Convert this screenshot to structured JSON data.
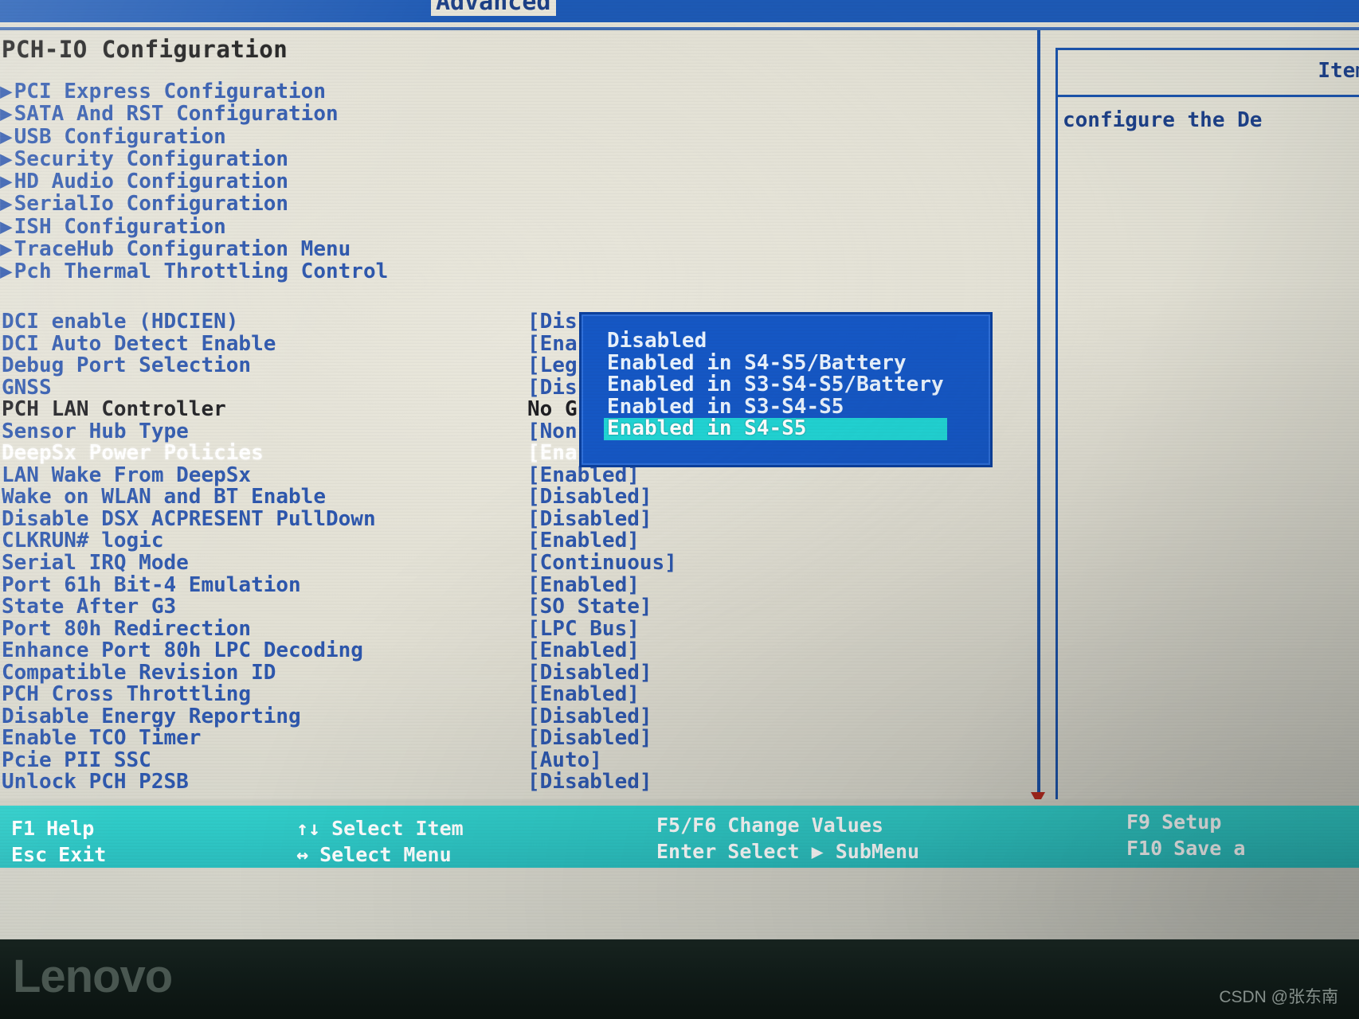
{
  "menubar": {
    "active_tab": "Advanced"
  },
  "page_title": "PCH-IO Configuration",
  "help_panel": {
    "title": "Item",
    "body": "configure the De"
  },
  "submenus": [
    {
      "label": "PCI Express Configuration"
    },
    {
      "label": "SATA And RST Configuration"
    },
    {
      "label": "USB Configuration"
    },
    {
      "label": "Security Configuration"
    },
    {
      "label": "HD Audio Configuration"
    },
    {
      "label": "SerialIo Configuration"
    },
    {
      "label": "ISH Configuration"
    },
    {
      "label": "TraceHub Configuration Menu"
    },
    {
      "label": "Pch Thermal Throttling Control"
    }
  ],
  "options": [
    {
      "label": "DCI enable (HDCIEN)",
      "value": "[Dis",
      "state": "normal"
    },
    {
      "label": "DCI Auto Detect Enable",
      "value": "[Ena",
      "state": "normal"
    },
    {
      "label": "Debug Port Selection",
      "value": "[Leg",
      "state": "normal"
    },
    {
      "label": "GNSS",
      "value": "[Dis",
      "state": "normal"
    },
    {
      "label": "PCH LAN Controller",
      "value": "No G",
      "state": "info"
    },
    {
      "label": "Sensor Hub Type",
      "value": "[Non",
      "state": "normal"
    },
    {
      "label": "DeepSx Power Policies",
      "value": "[Ena",
      "state": "selected"
    },
    {
      "label": "LAN Wake From DeepSx",
      "value": "[Enabled]",
      "state": "normal"
    },
    {
      "label": "Wake on WLAN and BT Enable",
      "value": "[Disabled]",
      "state": "normal"
    },
    {
      "label": "Disable DSX ACPRESENT PullDown",
      "value": "[Disabled]",
      "state": "normal"
    },
    {
      "label": "CLKRUN# logic",
      "value": "[Enabled]",
      "state": "normal"
    },
    {
      "label": "Serial IRQ Mode",
      "value": "[Continuous]",
      "state": "normal"
    },
    {
      "label": "Port 61h Bit-4 Emulation",
      "value": "[Enabled]",
      "state": "normal"
    },
    {
      "label": "State After G3",
      "value": "[SO State]",
      "state": "normal"
    },
    {
      "label": "Port 80h Redirection",
      "value": "[LPC Bus]",
      "state": "normal"
    },
    {
      "label": "Enhance Port 80h LPC Decoding",
      "value": "[Enabled]",
      "state": "normal"
    },
    {
      "label": "Compatible Revision ID",
      "value": "[Disabled]",
      "state": "normal"
    },
    {
      "label": "PCH Cross Throttling",
      "value": "[Enabled]",
      "state": "normal"
    },
    {
      "label": "Disable Energy Reporting",
      "value": "[Disabled]",
      "state": "normal"
    },
    {
      "label": "Enable TCO Timer",
      "value": "[Disabled]",
      "state": "normal"
    },
    {
      "label": "Pcie PII SSC",
      "value": "[Auto]",
      "state": "normal"
    },
    {
      "label": "Unlock PCH P2SB",
      "value": "[Disabled]",
      "state": "normal"
    }
  ],
  "popup": {
    "items": [
      {
        "label": "Disabled",
        "selected": false
      },
      {
        "label": "Enabled in S4-S5/Battery",
        "selected": false
      },
      {
        "label": "Enabled in S3-S4-S5/Battery",
        "selected": false
      },
      {
        "label": "Enabled in S3-S4-S5",
        "selected": false
      },
      {
        "label": "Enabled in S4-S5",
        "selected": true
      }
    ]
  },
  "legend": {
    "col1": {
      "line1_key": "F1",
      "line1_text": "Help",
      "line2_key": "Esc",
      "line2_text": "Exit"
    },
    "col2": {
      "line1_key": "↑↓",
      "line1_text": "Select Item",
      "line2_key": "↔",
      "line2_text": "Select Menu"
    },
    "col3": {
      "line1_key": "F5/F6",
      "line1_text": "Change Values",
      "line2_key": "Enter",
      "line2_text": "Select ▶ SubMenu"
    },
    "col4": {
      "line1_key": "F9",
      "line1_text": "Setup",
      "line2_key": "F10",
      "line2_text": "Save a"
    }
  },
  "bezel": {
    "brand": "Lenovo",
    "watermark": "CSDN @张东南"
  },
  "colors": {
    "menubar_blue": "#1d59b4",
    "text_blue": "#2d57ad",
    "popup_blue": "#1557c4",
    "popup_highlight": "#21d4d4",
    "legend_teal": "#2ec6c4",
    "screen_bg": "#e2e0d4"
  }
}
